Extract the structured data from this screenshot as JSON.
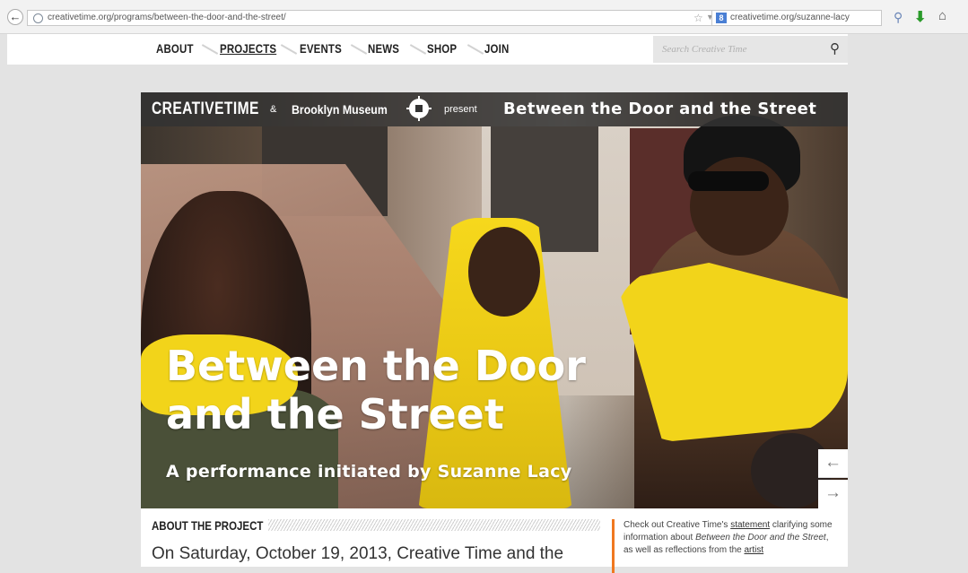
{
  "browser": {
    "url": "creativetime.org/programs/between-the-door-and-the-street/",
    "search_engine_letter": "8",
    "search_text": "creativetime.org/suzanne-lacy"
  },
  "nav": {
    "items": [
      "ABOUT",
      "PROJECTS",
      "EVENTS",
      "NEWS",
      "SHOP",
      "JOIN"
    ],
    "active": "PROJECTS",
    "search_placeholder": "Search Creative Time"
  },
  "hero": {
    "brand_primary": "CREATIVETIME",
    "amp": "&",
    "brand_secondary": "Brooklyn Museum",
    "present": "present",
    "banner_title": "Between the Door and the Street",
    "headline_line1": "Between the Door",
    "headline_line2": "and the Street",
    "subline": "A performance initiated by Suzanne Lacy",
    "prev_arrow": "←",
    "next_arrow": "→",
    "accent_color": "#f2d41a"
  },
  "about": {
    "heading": "ABOUT THE PROJECT",
    "body": "On Saturday, October 19, 2013, Creative Time and the",
    "note": {
      "prefix": "Check out Creative Time's ",
      "link1": "statement",
      "middle": " clarifying some information about ",
      "title": "Between the Door and the Street",
      "suffix": ", as well as reflections from the ",
      "link2": "artist",
      "accent_color": "#f07820"
    }
  }
}
